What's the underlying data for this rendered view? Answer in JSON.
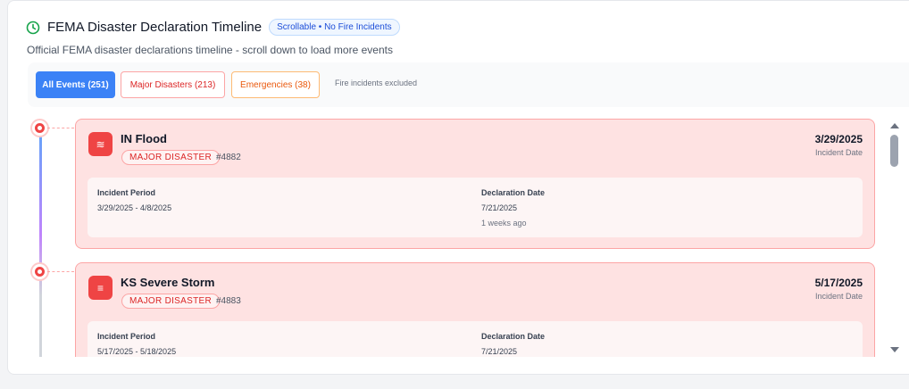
{
  "header": {
    "title": "FEMA Disaster Declaration Timeline",
    "pill": "Scrollable • No Fire Incidents",
    "subtitle": "Official FEMA disaster declarations timeline - scroll down to load more events",
    "icon": "clock-icon",
    "accent": "#16a34a"
  },
  "filters": {
    "all": "All Events (251)",
    "major": "Major Disasters (213)",
    "emergencies": "Emergencies (38)",
    "note": "Fire incidents excluded"
  },
  "events": [
    {
      "icon": "flood-icon",
      "icon_glyph": "≋",
      "title": "IN Flood",
      "badge": "MAJOR DISASTER",
      "number": "#4882",
      "date": "3/29/2025",
      "date_caption": "Incident Date",
      "period_label": "Incident Period",
      "period": "3/29/2025 - 4/8/2025",
      "declaration_label": "Declaration Date",
      "declaration": "7/21/2025",
      "ago": "1 weeks ago"
    },
    {
      "icon": "storm-icon",
      "icon_glyph": "≡",
      "title": "KS Severe Storm",
      "badge": "MAJOR DISASTER",
      "number": "#4883",
      "date": "5/17/2025",
      "date_caption": "Incident Date",
      "period_label": "Incident Period",
      "period": "5/17/2025 - 5/18/2025",
      "declaration_label": "Declaration Date",
      "declaration": "7/21/2025"
    }
  ]
}
